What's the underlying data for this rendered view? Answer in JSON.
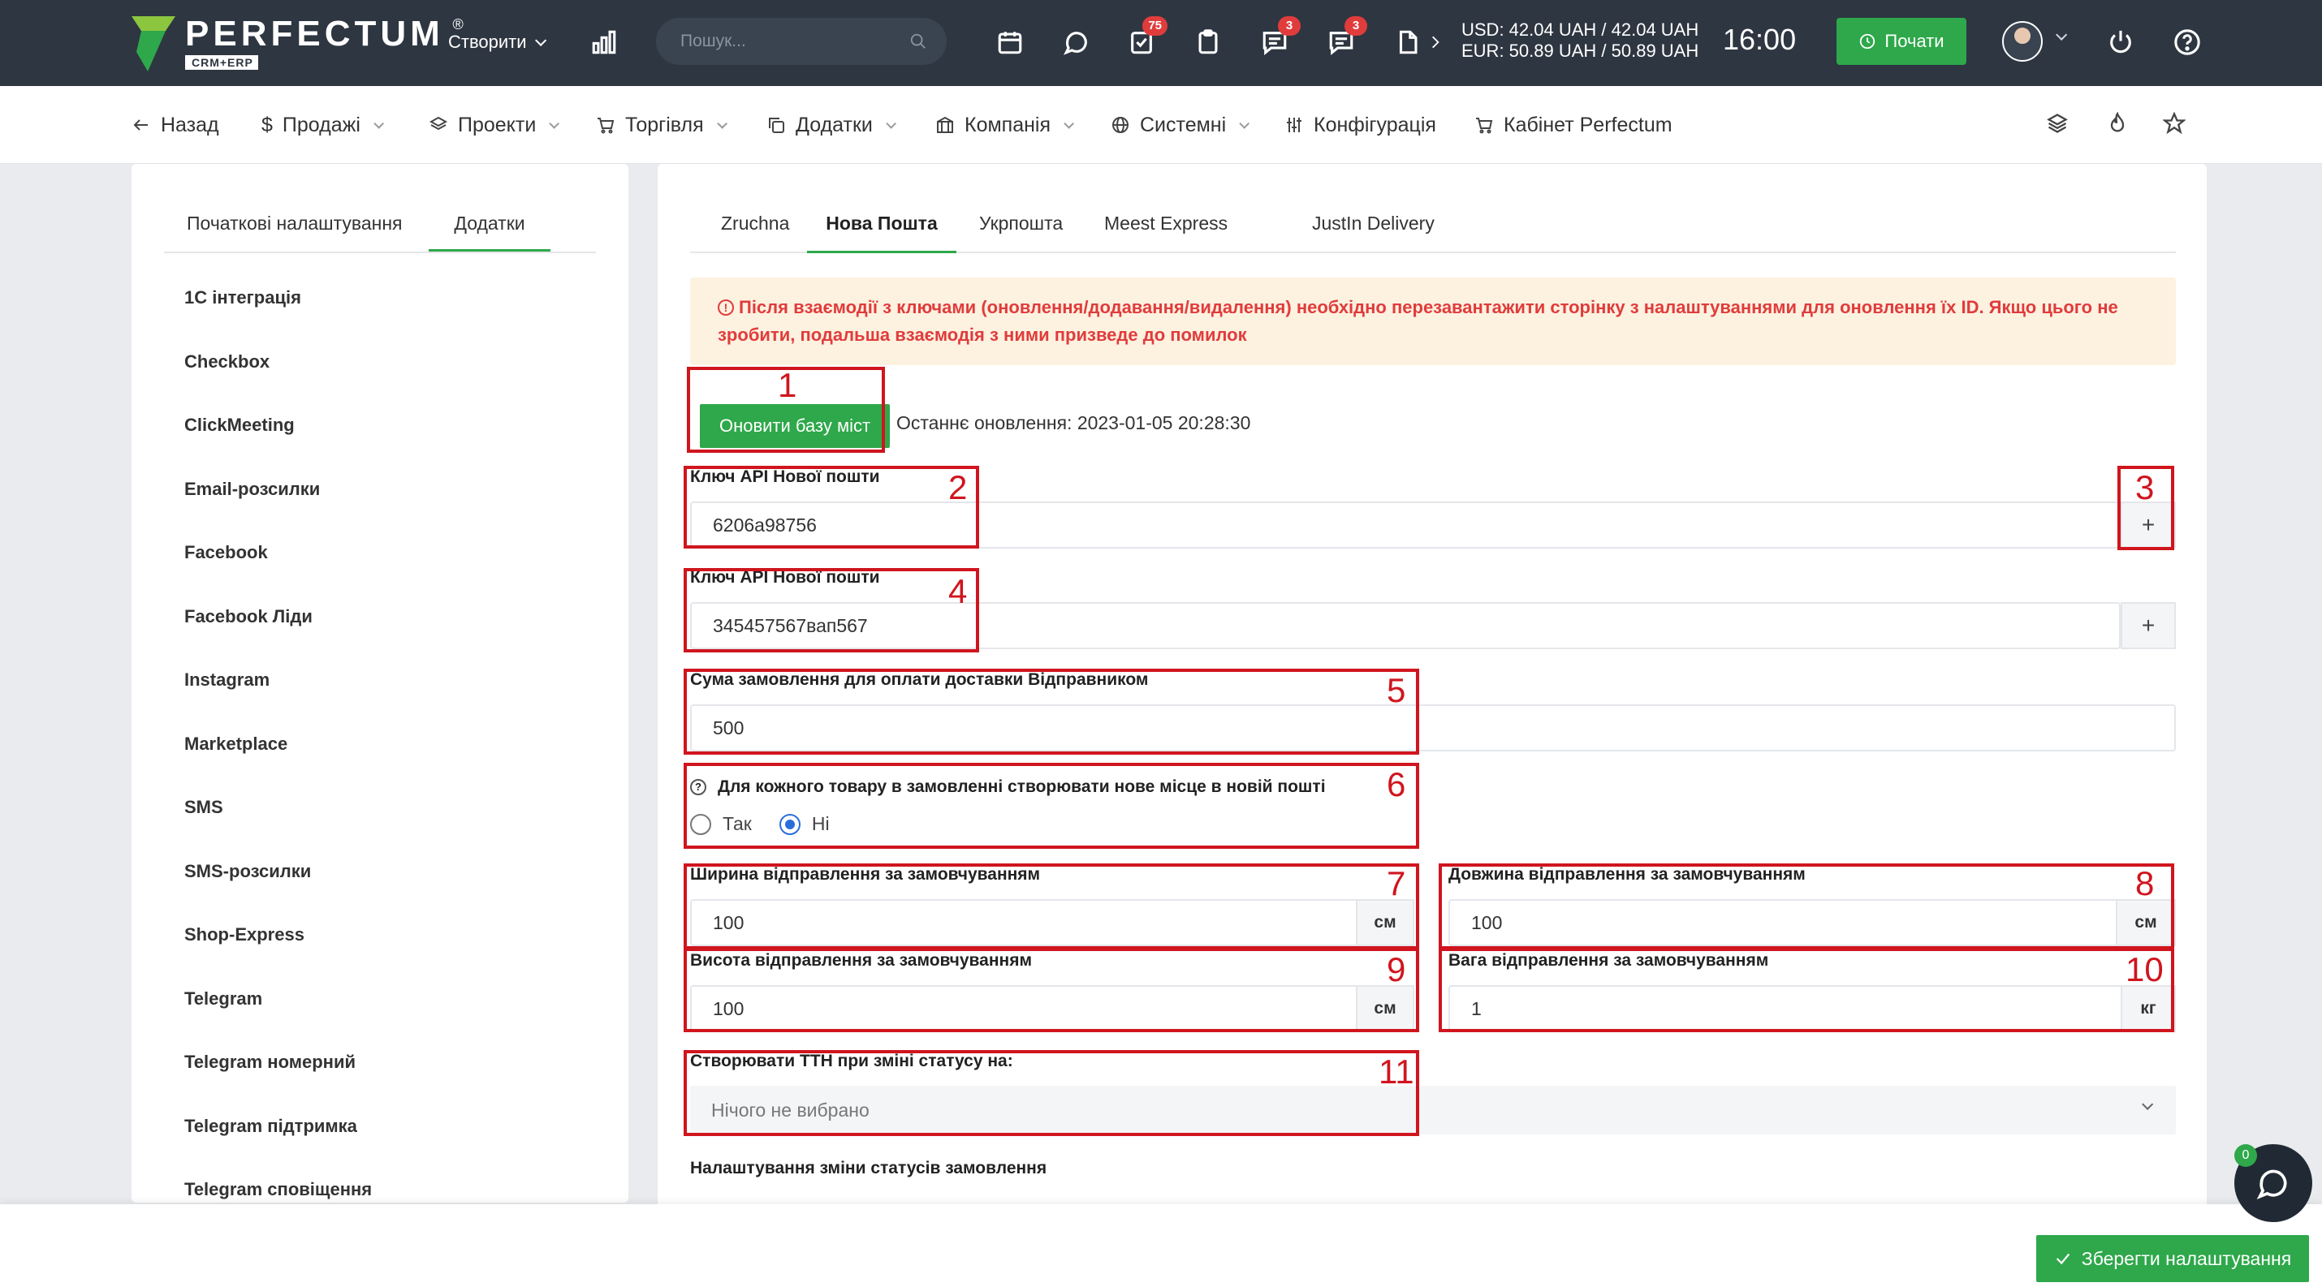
{
  "topbar": {
    "logo_name": "PERFECTUM",
    "logo_reg": "®",
    "logo_sub": "CRM+ERP",
    "create_label": "Створити",
    "search_placeholder": "Пошук...",
    "badges": {
      "tasks": "75",
      "messages": "3",
      "chat": "3"
    },
    "currency_usd": "USD: 42.04 UAH / 42.04 UAH",
    "currency_eur": "EUR: 50.89 UAH / 50.89 UAH",
    "time": "16:00",
    "start_label": "Почати"
  },
  "subnav": {
    "back": "Назад",
    "items": [
      "Продажі",
      "Проекти",
      "Торгівля",
      "Додатки",
      "Компанія",
      "Системні",
      "Конфігурація",
      "Кабінет Perfectum"
    ]
  },
  "left": {
    "tabs": [
      "Початкові налаштування",
      "Додатки"
    ],
    "active_tab": "Додатки",
    "items": [
      "1С інтеграція",
      "Checkbox",
      "ClickMeeting",
      "Email-розсилки",
      "Facebook",
      "Facebook Ліди",
      "Instagram",
      "Marketplace",
      "SMS",
      "SMS-розсилки",
      "Shop-Express",
      "Telegram",
      "Telegram номерний",
      "Telegram підтримка",
      "Telegram сповіщення"
    ]
  },
  "main": {
    "tabs": [
      "Zruchna",
      "Нова Пошта",
      "Укрпошта",
      "Meest Express",
      "JustIn Delivery"
    ],
    "active_tab": "Нова Пошта",
    "alert_line1": "Після взаємодії з ключами (оновлення/додавання/видалення) необхідно перезавантажити сторінку з налаштуваннями для оновлення їх ID. Якщо цього не",
    "alert_line2": "зробити, подальша взаємодія з ними призведе до помилок",
    "refresh_button": "Оновити базу міст",
    "last_update": "Останнє оновлення: 2023-01-05 20:28:30",
    "api_key_label_1": "Ключ API Нової пошти",
    "api_key_value_1": "6206a98756",
    "api_key_label_2": "Ключ API Нової пошти",
    "api_key_value_2": "345457567вап567",
    "plus": "+",
    "sum_label": "Сума замовлення для оплати доставки Відправником",
    "sum_value": "500",
    "new_place_label": "Для кожного товару в замовленні створювати нове місце в новій пошті",
    "radio_yes": "Так",
    "radio_no": "Ні",
    "radio_selected": "Ні",
    "width_label": "Ширина відправлення за замовчуванням",
    "width_value": "100",
    "length_label": "Довжина відправлення за замовчуванням",
    "length_value": "100",
    "height_label": "Висота відправлення за замовчуванням",
    "height_value": "100",
    "weight_label": "Вага відправлення за замовчуванням",
    "weight_value": "1",
    "unit_cm": "см",
    "unit_kg": "кг",
    "ttn_label": "Створювати ТТН при зміні статусу на:",
    "ttn_placeholder": "Нічого не вибрано",
    "status_section": "Налаштування зміни статусів замовлення"
  },
  "annotations": [
    "1",
    "2",
    "3",
    "4",
    "5",
    "6",
    "7",
    "8",
    "9",
    "10",
    "11"
  ],
  "footer": {
    "save_label": "Зберегти налаштування",
    "chat_count": "0"
  },
  "colors": {
    "topbar_bg": "#2e3641",
    "accent_green": "#2ea84a",
    "annotation_red": "#d0151e",
    "alert_bg": "#fdf1e0",
    "alert_text": "#e03c3c",
    "badge_red": "#e03c3c"
  }
}
